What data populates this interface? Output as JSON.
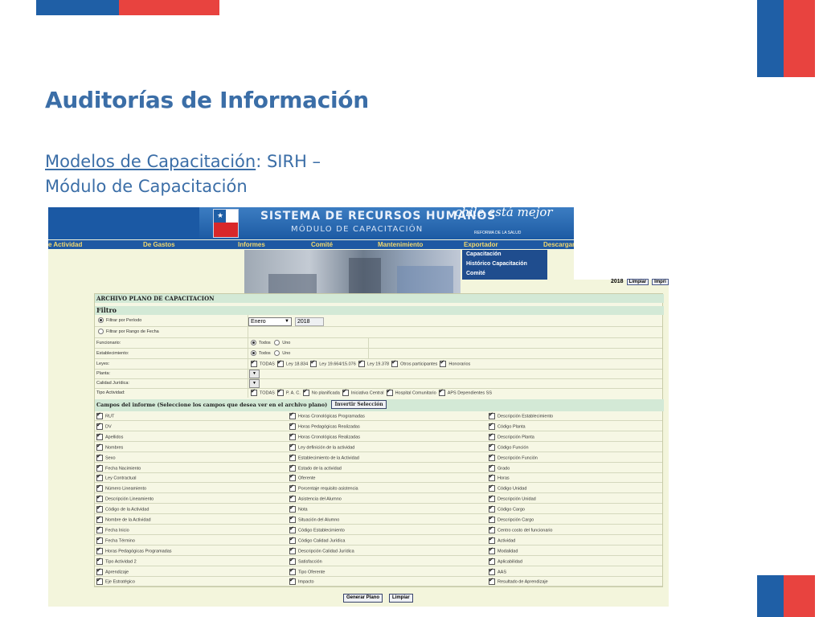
{
  "slide": {
    "title": "Auditorías de Información",
    "subtitle_link": "Modelos de Capacitación",
    "subtitle_rest": ": SIRH –",
    "subtitle_line2": "Módulo de Capacitación",
    "colors": {
      "blue": "#1f5fa6",
      "red": "#e8433f",
      "title": "#3b6ea7"
    }
  },
  "app": {
    "banner_title": "SISTEMA DE RECURSOS HUMANOS",
    "banner_subtitle": "MÓDULO DE CAPACITACIÓN",
    "logo_script": "chile está mejor",
    "logo_tagline": "REFORMA DE LA SALUD",
    "menu": [
      "e Actividad",
      "De Gastos",
      "Informes",
      "Comité",
      "Mantenimiento",
      "Exportador",
      "Descargar ("
    ],
    "dropdown": [
      "Capacitación",
      "Histórico Capacitación",
      "Comité"
    ],
    "toolbar": {
      "year": "2018",
      "clear": "Limpiar",
      "print": "Impri"
    }
  },
  "form": {
    "section_title": "ARCHIVO PLANO DE CAPACITACION",
    "filter_title": "Filtro",
    "period_radio": "Filtrar por Período",
    "range_radio": "Filtrar por Rango de Fecha",
    "month": "Enero",
    "year": "2018",
    "funcionario_label": "Funcionario:",
    "establecimiento_label": "Establecimiento:",
    "leyes_label": "Leyes:",
    "planta_label": "Planta:",
    "calidad_label": "Calidad Jurídica:",
    "tipo_label": "Tipo Actividad:",
    "todos": "Todos",
    "uno": "Uno",
    "leyes": [
      "TODAS",
      "Ley 18.834",
      "Ley 19.664/15.076",
      "Ley 19.378",
      "Otros participantes",
      "Honorarios"
    ],
    "tipos": [
      "TODAS",
      "P. A. C.",
      "No planificada",
      "Iniciativa Central",
      "Hospital Comunitario",
      "APS Dependientes SS"
    ],
    "fields_title": "Campos del informe (Seleccione los campos que desea ver en el archivo plano)",
    "invert_button": "Invertir Selección",
    "col1": [
      "RUT",
      "DV",
      "Apellidos",
      "Nombres",
      "Sexo",
      "Fecha Nacimiento",
      "Ley Contractual",
      "Número Lineamiento",
      "Descripción Lineamiento",
      "Código de la Actividad",
      "Nombre de la Actividad",
      "Fecha Inicio",
      "Fecha Término",
      "Horas Pedagógicas Programadas",
      "Tipo Actividad 2",
      "Aprendizaje",
      "Eje Estratégico"
    ],
    "col2": [
      "Horas Cronológicas Programadas",
      "Horas Pedagógicas Realizadas",
      "Horas Cronológicas Realizadas",
      "Ley definición de la actividad",
      "Establecimiento de la Actividad",
      "Estado de la actividad",
      "Oferente",
      "Porcentaje requisito asistencia",
      "Asistencia del Alumno",
      "Nota",
      "Situación del Alumno",
      "Código Establecimiento",
      "Código Calidad Jurídica",
      "Descripción Calidad Jurídica",
      "Satisfacción",
      "Tipo Oferente",
      "Impacto"
    ],
    "col3": [
      "Descripción Establecimiento",
      "Código Planta",
      "Descripción Planta",
      "Código Función",
      "Descripción Función",
      "Grado",
      "Horas",
      "Código Unidad",
      "Descripción Unidad",
      "Código Cargo",
      "Descripción Cargo",
      "Centro costo del funcionario",
      "Actividad",
      "Modalidad",
      "Aplicabilidad",
      "AAS",
      "Resultado de Aprendizaje"
    ],
    "generate_button": "Generar Plano",
    "clear_button": "Limpiar"
  }
}
